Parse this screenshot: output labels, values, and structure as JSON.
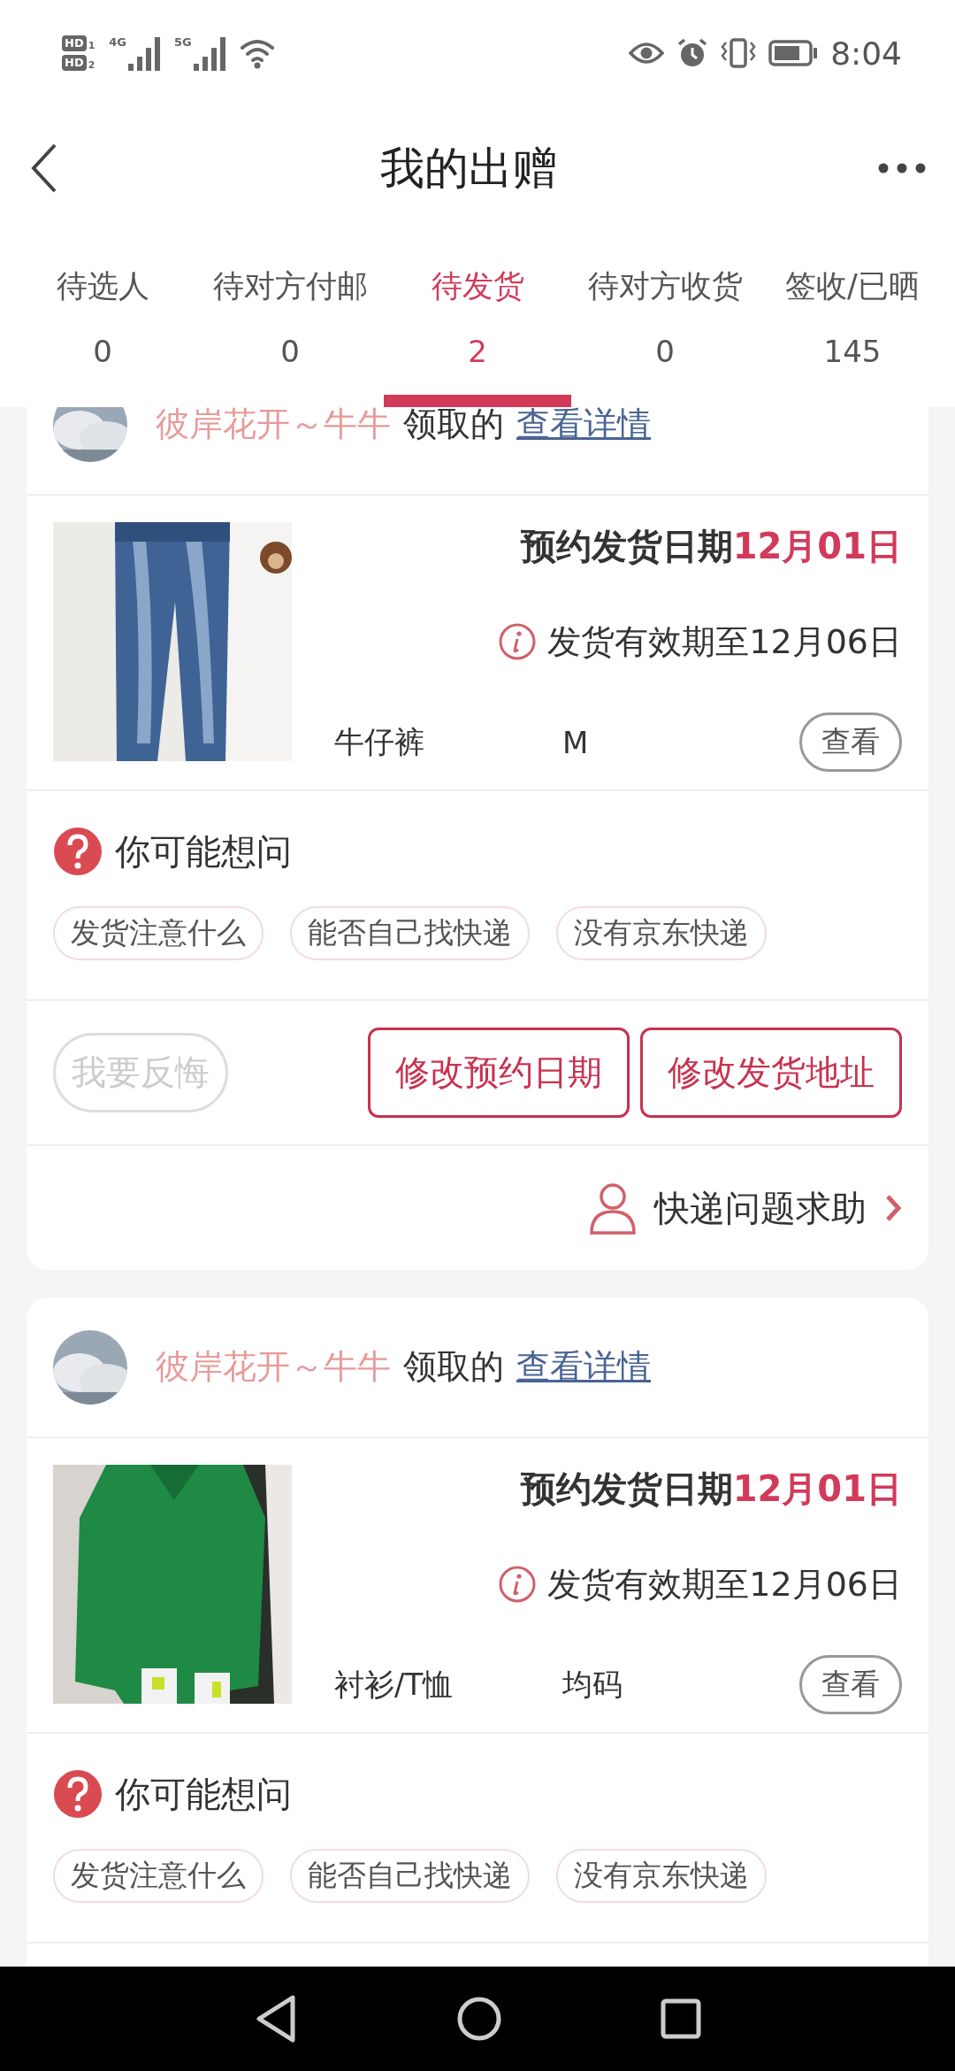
{
  "status_bar": {
    "sims": [
      {
        "badge": "HD",
        "slot": "1"
      },
      {
        "badge": "HD",
        "slot": "2"
      }
    ],
    "networks": [
      "4G",
      "5G"
    ],
    "time": "8:04"
  },
  "header": {
    "title": "我的出赠"
  },
  "tabs": [
    {
      "label": "待选人",
      "count": "0",
      "selected": false
    },
    {
      "label": "待对方付邮",
      "count": "0",
      "selected": false
    },
    {
      "label": "待发货",
      "count": "2",
      "selected": true
    },
    {
      "label": "待对方收货",
      "count": "0",
      "selected": false
    },
    {
      "label": "签收/已晒",
      "count": "145",
      "selected": false
    }
  ],
  "cards": [
    {
      "receiver": "彼岸花开～牛牛",
      "receiver_suffix": "领取的",
      "details_link": "查看详情",
      "schedule_label": "预约发货日期",
      "schedule_date": "12月01日",
      "deadline": "发货有效期至12月06日",
      "item_name": "牛仔裤",
      "item_size": "M",
      "view_button": "查看",
      "faq_title": "你可能想问",
      "faq_chips": [
        "发货注意什么",
        "能否自己找快递",
        "没有京东快递"
      ],
      "actions": [
        {
          "label": "我要反悔",
          "disabled": true
        },
        {
          "label": "修改预约日期",
          "disabled": false
        },
        {
          "label": "修改发货地址",
          "disabled": false
        }
      ],
      "help": "快递问题求助"
    },
    {
      "receiver": "彼岸花开～牛牛",
      "receiver_suffix": "领取的",
      "details_link": "查看详情",
      "schedule_label": "预约发货日期",
      "schedule_date": "12月01日",
      "deadline": "发货有效期至12月06日",
      "item_name": "衬衫/T恤",
      "item_size": "均码",
      "view_button": "查看",
      "faq_title": "你可能想问",
      "faq_chips": [
        "发货注意什么",
        "能否自己找快递",
        "没有京东快递"
      ]
    }
  ]
}
